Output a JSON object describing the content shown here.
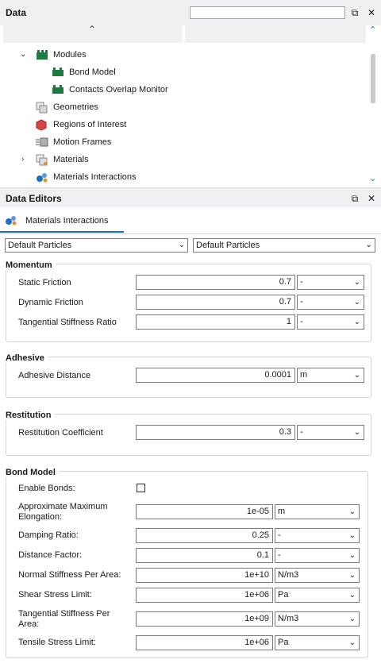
{
  "data_panel": {
    "title": "Data",
    "search_value": "",
    "tree": [
      {
        "label": "Modules",
        "expanded": true,
        "icon": "modules-icon"
      },
      {
        "label": "Bond Model",
        "icon": "module-icon"
      },
      {
        "label": "Contacts Overlap Monitor",
        "icon": "module-icon"
      },
      {
        "label": "Geometries",
        "icon": "geometries-icon"
      },
      {
        "label": "Regions of Interest",
        "icon": "region-icon"
      },
      {
        "label": "Motion Frames",
        "icon": "motion-frames-icon"
      },
      {
        "label": "Materials",
        "expanded": false,
        "icon": "materials-icon"
      },
      {
        "label": "Materials Interactions",
        "icon": "materials-interactions-icon"
      }
    ]
  },
  "editors_panel": {
    "title": "Data Editors",
    "tab_label": "Materials Interactions",
    "material_a": "Default Particles",
    "material_b": "Default Particles"
  },
  "momentum": {
    "title": "Momentum",
    "rows": [
      {
        "label": "Static Friction",
        "value": "0.7",
        "unit": "-"
      },
      {
        "label": "Dynamic Friction",
        "value": "0.7",
        "unit": "-"
      },
      {
        "label": "Tangential Stiffness Ratio",
        "value": "1",
        "unit": "-"
      }
    ]
  },
  "adhesive": {
    "title": "Adhesive",
    "rows": [
      {
        "label": "Adhesive Distance",
        "value": "0.0001",
        "unit": "m"
      }
    ]
  },
  "restitution": {
    "title": "Restitution",
    "rows": [
      {
        "label": "Restitution Coefficient",
        "value": "0.3",
        "unit": "-"
      }
    ]
  },
  "bond_model": {
    "title": "Bond Model",
    "enable_label": "Enable Bonds:",
    "enable_checked": false,
    "rows": [
      {
        "label": "Approximate Maximum Elongation:",
        "value": "1e-05",
        "unit": "m"
      },
      {
        "label": "Damping Ratio:",
        "value": "0.25",
        "unit": "-"
      },
      {
        "label": "Distance Factor:",
        "value": "0.1",
        "unit": "-"
      },
      {
        "label": "Normal Stiffness Per Area:",
        "value": "1e+10",
        "unit": "N/m3"
      },
      {
        "label": "Shear Stress Limit:",
        "value": "1e+06",
        "unit": "Pa"
      },
      {
        "label": "Tangential Stiffness Per Area:",
        "value": "1e+09",
        "unit": "N/m3"
      },
      {
        "label": "Tensile Stress Limit:",
        "value": "1e+06",
        "unit": "Pa"
      }
    ]
  },
  "colors": {
    "module_green": "#1e7a3e",
    "accent_blue": "#1a6fc4",
    "header_bg": "#eef0f3"
  }
}
